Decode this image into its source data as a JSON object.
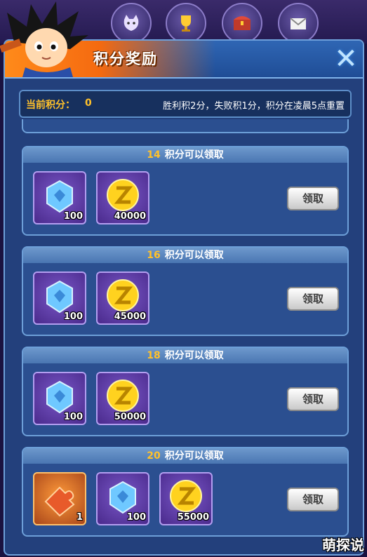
{
  "header": {
    "title": "积分奖励",
    "close_label": "✕",
    "top_icons": [
      "cat-icon",
      "trophy-icon",
      "chest-icon",
      "mail-icon"
    ]
  },
  "info": {
    "points_label": "当前积分：",
    "points_value": "0",
    "rule": "胜利积2分，失败积1分，积分在凌晨5点重置"
  },
  "rewards": [
    {
      "points": "14",
      "suffix": "积分可以领取",
      "button": "领取",
      "items": [
        {
          "icon": "blue-crystal-icon",
          "count": "100"
        },
        {
          "icon": "gold-z-coin-icon",
          "count": "40000"
        }
      ]
    },
    {
      "points": "16",
      "suffix": "积分可以领取",
      "button": "领取",
      "items": [
        {
          "icon": "blue-crystal-icon",
          "count": "100"
        },
        {
          "icon": "gold-z-coin-icon",
          "count": "45000"
        }
      ]
    },
    {
      "points": "18",
      "suffix": "积分可以领取",
      "button": "领取",
      "items": [
        {
          "icon": "blue-crystal-icon",
          "count": "100"
        },
        {
          "icon": "gold-z-coin-icon",
          "count": "50000"
        }
      ]
    },
    {
      "points": "20",
      "suffix": "积分可以领取",
      "button": "领取",
      "items": [
        {
          "icon": "puzzle-piece-icon",
          "count": "1"
        },
        {
          "icon": "blue-crystal-icon",
          "count": "100"
        },
        {
          "icon": "gold-z-coin-icon",
          "count": "55000"
        }
      ]
    }
  ],
  "watermark": "萌探说"
}
